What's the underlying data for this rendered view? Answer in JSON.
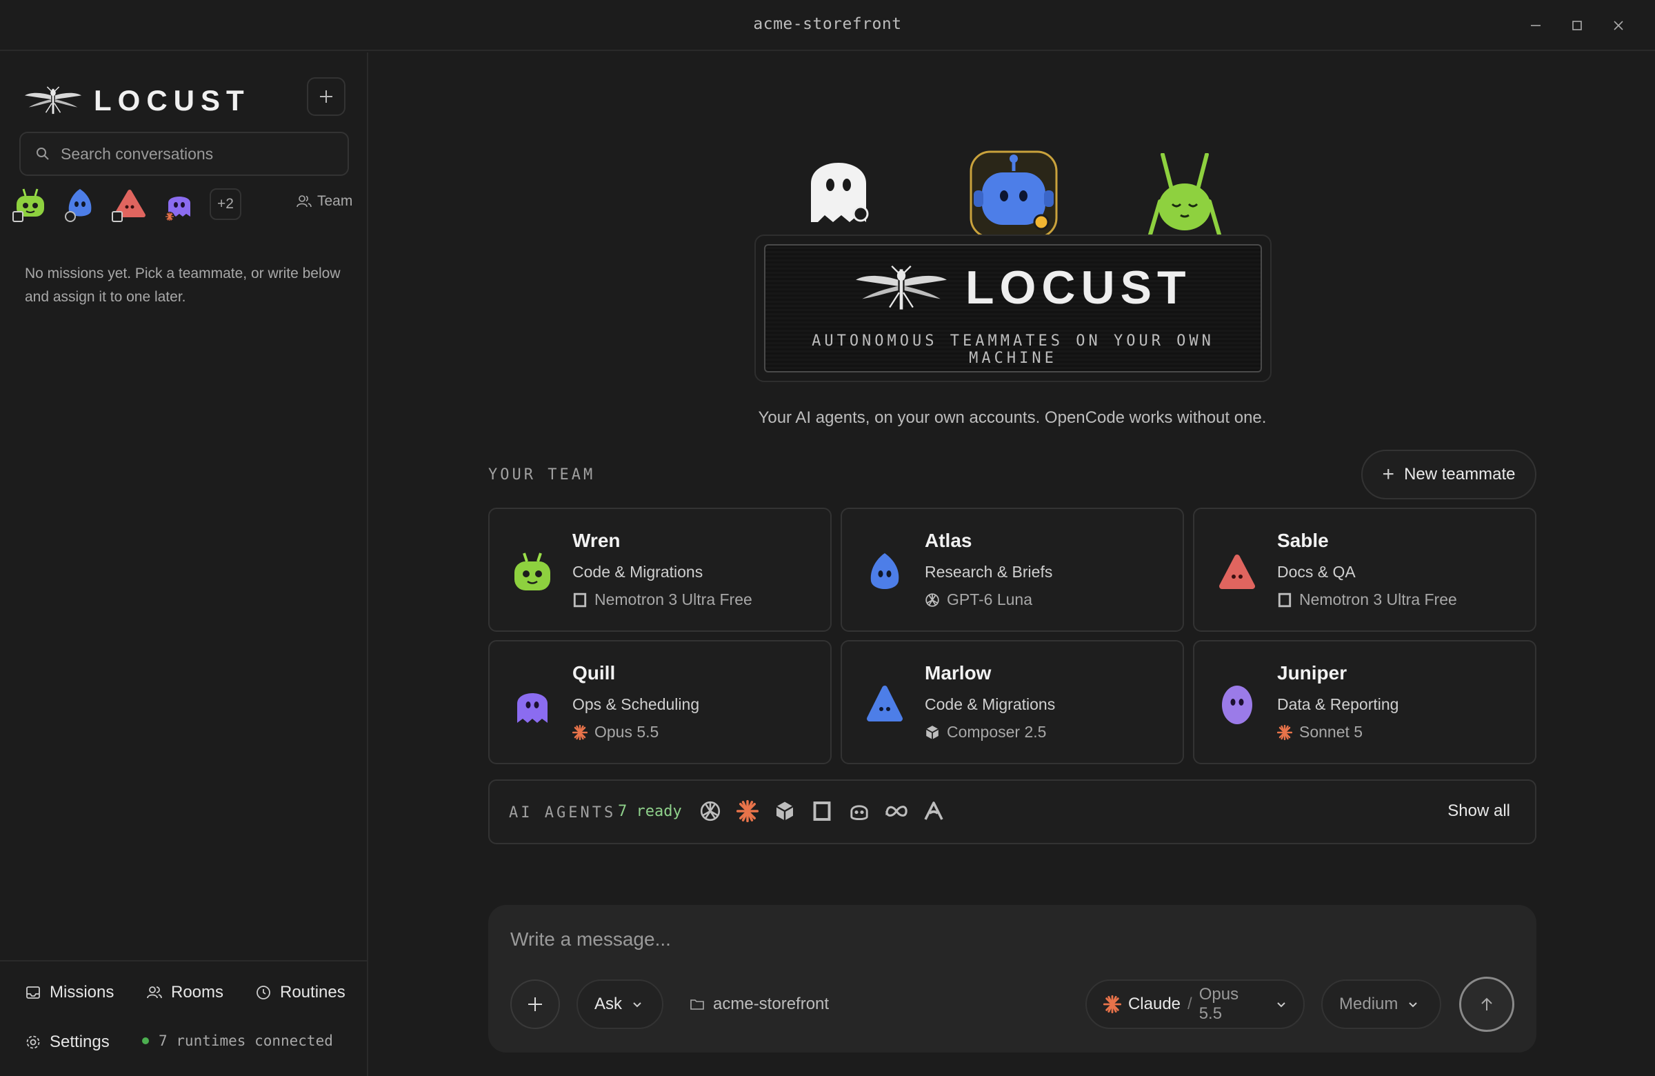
{
  "window": {
    "title": "acme-storefront"
  },
  "sidebar": {
    "brand": "LOCUST",
    "search_placeholder": "Search conversations",
    "extra_count": "+2",
    "team_label": "Team",
    "empty_note": "No missions yet. Pick a teammate, or write below and assign it to one later.",
    "nav": {
      "missions": "Missions",
      "rooms": "Rooms",
      "routines": "Routines",
      "settings": "Settings"
    },
    "status": "7 runtimes connected"
  },
  "hero": {
    "brand": "LOCUST",
    "subtitle": "AUTONOMOUS TEAMMATES ON YOUR OWN MACHINE",
    "tagline": "Your AI agents, on your own accounts. OpenCode works without one."
  },
  "team": {
    "label": "YOUR TEAM",
    "new_button": "New teammate",
    "members": [
      {
        "name": "Wren",
        "role": "Code & Migrations",
        "model": "Nemotron 3 Ultra Free",
        "icon": "square-icon",
        "mascot": "green-robot"
      },
      {
        "name": "Atlas",
        "role": "Research & Briefs",
        "model": "GPT-6 Luna",
        "icon": "openai-icon",
        "mascot": "blue-drop"
      },
      {
        "name": "Sable",
        "role": "Docs & QA",
        "model": "Nemotron 3 Ultra Free",
        "icon": "square-icon",
        "mascot": "red-triangle"
      },
      {
        "name": "Quill",
        "role": "Ops & Scheduling",
        "model": "Opus 5.5",
        "icon": "claude-icon",
        "mascot": "purple-ghost"
      },
      {
        "name": "Marlow",
        "role": "Code & Migrations",
        "model": "Composer 2.5",
        "icon": "cube-icon",
        "mascot": "blue-triangle"
      },
      {
        "name": "Juniper",
        "role": "Data & Reporting",
        "model": "Sonnet 5",
        "icon": "claude-icon",
        "mascot": "violet-egg"
      }
    ]
  },
  "agents": {
    "label": "AI AGENTS",
    "ready": "7 ready",
    "icons": [
      "openai-icon",
      "claude-icon",
      "cube-icon",
      "square-icon",
      "copilot-icon",
      "meta-icon",
      "arrow-a-icon"
    ],
    "show_all": "Show all"
  },
  "composer": {
    "placeholder": "Write a message...",
    "mode": "Ask",
    "folder": "acme-storefront",
    "provider": "Claude",
    "separator": "/",
    "model": "Opus 5.5",
    "effort": "Medium"
  },
  "colors": {
    "background": "#1c1c1c",
    "accent_claude": "#e8734a",
    "ready_green": "#8fd18b",
    "status_green": "#4caf50"
  }
}
